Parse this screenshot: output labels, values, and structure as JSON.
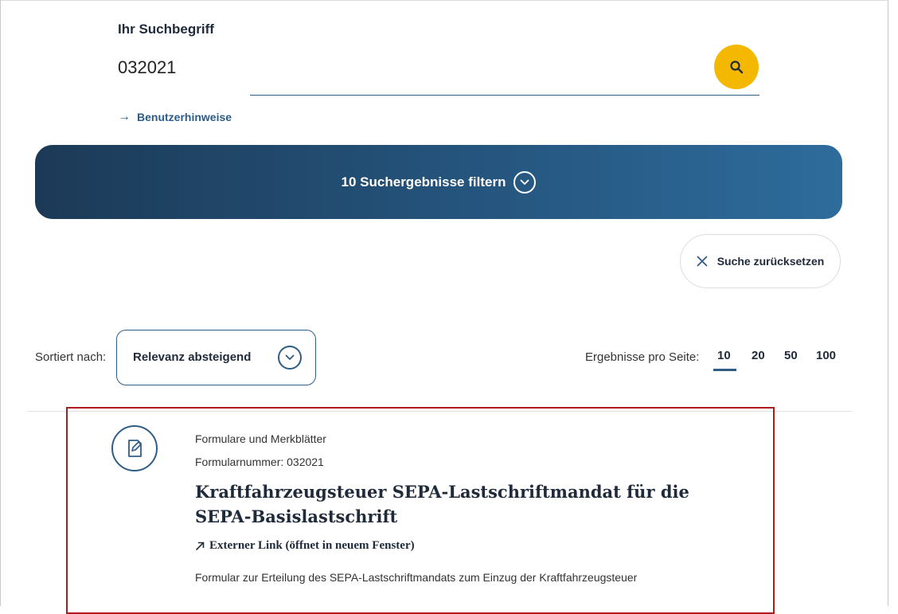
{
  "search": {
    "label": "Ihr Suchbegriff",
    "value": "032021",
    "button_icon": "search-icon",
    "help_link": "Benutzerhinweise"
  },
  "filter": {
    "label": "10 Suchergebnisse filtern",
    "icon": "chevron-down-icon"
  },
  "reset": {
    "label": "Suche zurücksetzen",
    "icon": "close-icon"
  },
  "sort": {
    "label": "Sortiert nach:",
    "selected": "Relevanz absteigend"
  },
  "per_page": {
    "label": "Ergebnisse pro Seite:",
    "options": [
      "10",
      "20",
      "50",
      "100"
    ],
    "selected": "10"
  },
  "result": {
    "icon": "edit-document-icon",
    "category": "Formulare und Merkblätter",
    "form_number": "Formularnummer: 032021",
    "title": "Kraftfahrzeugsteuer SEPA-Lastschriftmandat für die SEPA-Basislastschrift",
    "external_link": "Externer Link (öffnet in neuem Fenster)",
    "description": "Formular zur Erteilung des SEPA-Lastschriftmandats zum Einzug der Kraftfahrzeugsteuer"
  },
  "colors": {
    "accent_yellow": "#f5b800",
    "primary_blue": "#2f5d86",
    "highlight_border": "#b01c1c"
  }
}
